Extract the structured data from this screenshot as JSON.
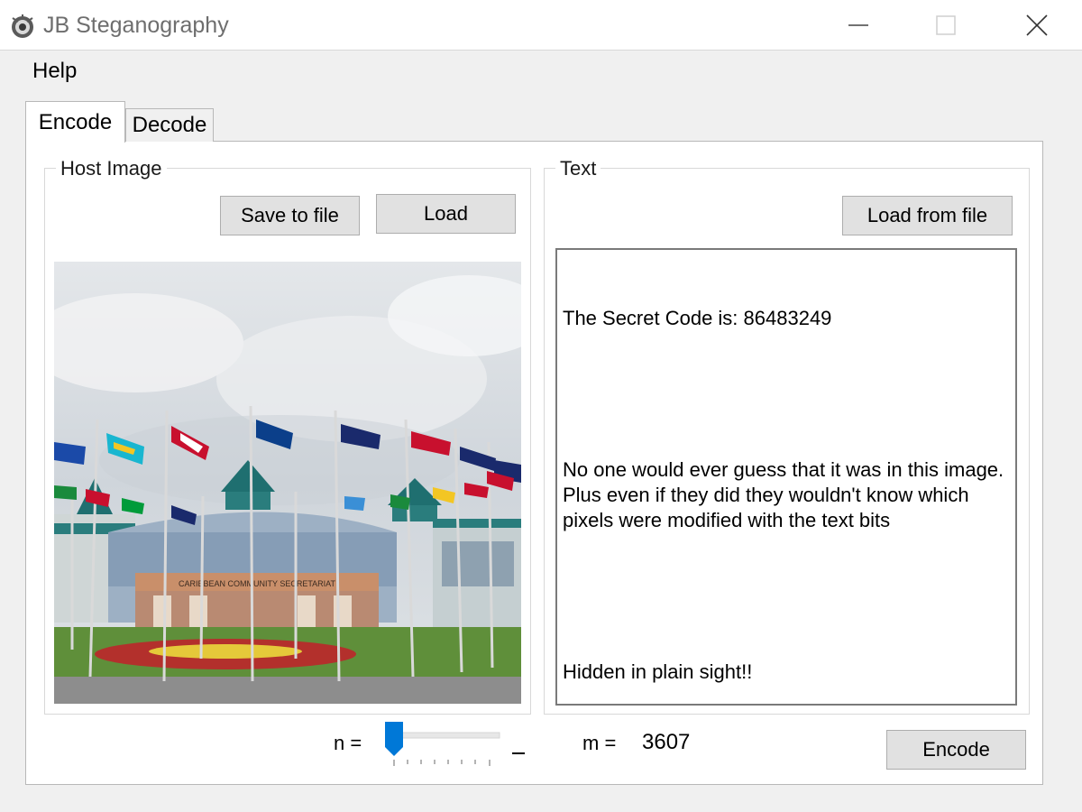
{
  "window": {
    "title": "JB Steganography",
    "icons": {
      "app": "app-logo-icon",
      "minimize": "minimize-icon",
      "maximize": "maximize-icon",
      "close": "close-icon"
    }
  },
  "menu": {
    "help": "Help"
  },
  "tabs": [
    {
      "label": "Encode",
      "active": true
    },
    {
      "label": "Decode",
      "active": false
    }
  ],
  "host_image": {
    "group_label": "Host Image",
    "save_label": "Save to file",
    "load_label": "Load",
    "sign_text": "CARIBBEAN COMMUNITY SECRETARIAT"
  },
  "text_panel": {
    "group_label": "Text",
    "load_label": "Load from file",
    "paragraphs": [
      "The Secret Code is: 86483249",
      "",
      "No one would ever guess that it was in this image. Plus even if they did they wouldn't know which pixels were modified with the text bits",
      "",
      "Hidden in plain sight!!"
    ]
  },
  "controls": {
    "n_label": "n =",
    "n_value": 1,
    "n_max": 8,
    "m_label": "m =",
    "m_value": "3607",
    "encode_label": "Encode"
  },
  "colors": {
    "accent": "#0078d7",
    "button_face": "#e1e1e1",
    "window_bg": "#f0f0f0"
  }
}
